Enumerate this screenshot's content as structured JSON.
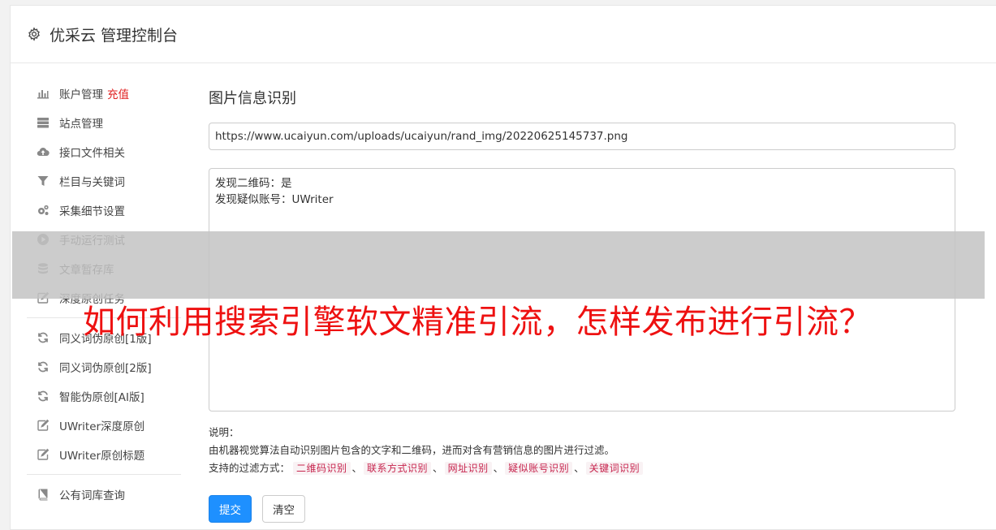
{
  "header": {
    "title": "优采云 管理控制台",
    "icon": "gear-icon"
  },
  "sidebar": {
    "groups": [
      [
        {
          "label": "账户管理",
          "badge": "充值",
          "icon": "bar-chart-icon"
        },
        {
          "label": "站点管理",
          "icon": "server-icon"
        },
        {
          "label": "接口文件相关",
          "icon": "cloud-upload-icon"
        },
        {
          "label": "栏目与关键词",
          "icon": "filter-icon"
        },
        {
          "label": "采集细节设置",
          "icon": "cogs-icon"
        },
        {
          "label": "手动运行测试",
          "icon": "play-circle-icon"
        },
        {
          "label": "文章暂存库",
          "icon": "database-icon"
        },
        {
          "label": "深度原创任务",
          "icon": "edit-icon"
        }
      ],
      [
        {
          "label": "同义词伪原创[1版]",
          "icon": "refresh-icon"
        },
        {
          "label": "同义词伪原创[2版]",
          "icon": "refresh-icon"
        },
        {
          "label": "智能伪原创[AI版]",
          "icon": "refresh-icon"
        },
        {
          "label": "UWriter深度原创",
          "icon": "edit-icon"
        },
        {
          "label": "UWriter原创标题",
          "icon": "edit-icon"
        }
      ],
      [
        {
          "label": "公有词库查询",
          "icon": "book-icon"
        }
      ]
    ]
  },
  "main": {
    "heading": "图片信息识别",
    "url_value": "https://www.ucaiyun.com/uploads/ucaiyun/rand_img/20220625145737.png",
    "result_lines": [
      "发现二维码：是",
      "发现疑似账号：UWriter"
    ],
    "note_label": "说明：",
    "note_desc": "由机器视觉算法自动识别图片包含的文字和二维码，进而对含有营销信息的图片进行过滤。",
    "filter_label": "支持的过滤方式：",
    "filters": [
      "二维码识别",
      "联系方式识别",
      "网址识别",
      "疑似账号识别",
      "关键词识别"
    ],
    "filter_sep": "、",
    "submit_label": "提交",
    "clear_label": "清空"
  },
  "overlay": {
    "text": "如何利用搜索引擎软文精准引流，怎样发布进行引流？"
  }
}
